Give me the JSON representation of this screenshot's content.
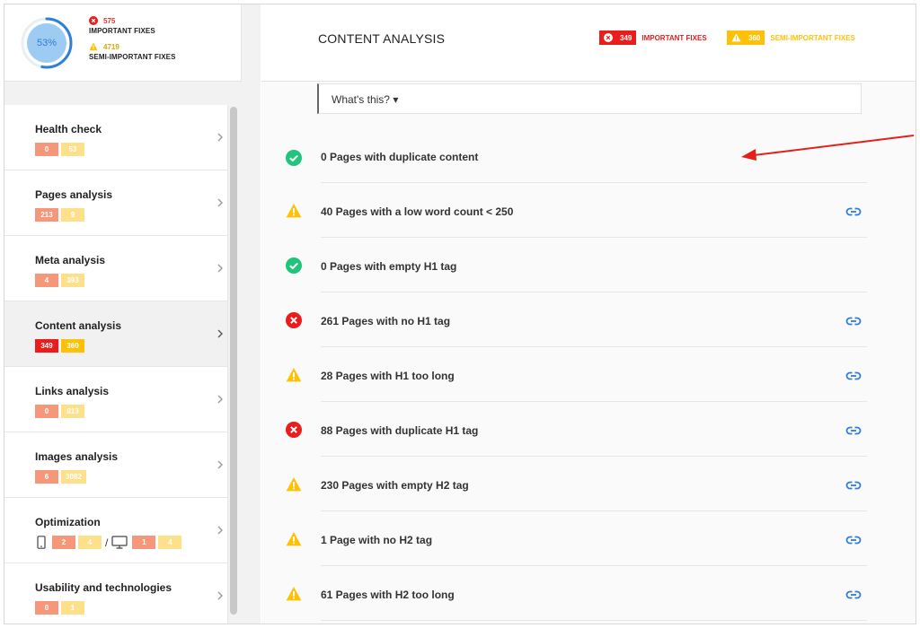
{
  "summary": {
    "score": "53%",
    "score_fraction": 0.53,
    "important_count": "575",
    "important_label": "IMPORTANT FIXES",
    "semi_count": "4719",
    "semi_label": "SEMI-IMPORTANT FIXES"
  },
  "nav": [
    {
      "title": "Health check",
      "badges": [
        "0",
        "53"
      ]
    },
    {
      "title": "Pages analysis",
      "badges": [
        "213",
        "9"
      ]
    },
    {
      "title": "Meta analysis",
      "badges": [
        "4",
        "393"
      ]
    },
    {
      "title": "Content analysis",
      "badges": [
        "349",
        "360"
      ]
    },
    {
      "title": "Links analysis",
      "badges": [
        "0",
        "813"
      ]
    },
    {
      "title": "Images analysis",
      "badges": [
        "6",
        "3082"
      ]
    },
    {
      "title": "Optimization",
      "mobile_badges": [
        "2",
        "4"
      ],
      "separator": "/",
      "desktop_badges": [
        "1",
        "4"
      ]
    },
    {
      "title": "Usability and technologies",
      "badges": [
        "0",
        "1"
      ]
    }
  ],
  "header": {
    "title": "CONTENT ANALYSIS",
    "important_count": "349",
    "important_label": "IMPORTANT FIXES",
    "semi_count": "360",
    "semi_label": "SEMI-IMPORTANT FIXES"
  },
  "whats_this": "What's this? ▾",
  "checks": [
    {
      "status": "ok",
      "text": "0 Pages with duplicate content",
      "link": false
    },
    {
      "status": "warn",
      "text": "40 Pages with a low word count < 250",
      "link": true
    },
    {
      "status": "ok",
      "text": "0 Pages with empty H1 tag",
      "link": false
    },
    {
      "status": "error",
      "text": "261 Pages with no H1 tag",
      "link": true
    },
    {
      "status": "warn",
      "text": "28 Pages with H1 too long",
      "link": true
    },
    {
      "status": "error",
      "text": "88 Pages with duplicate H1 tag",
      "link": true
    },
    {
      "status": "warn",
      "text": "230 Pages with empty H2 tag",
      "link": true
    },
    {
      "status": "warn",
      "text": "1 Page with no H2 tag",
      "link": true
    },
    {
      "status": "warn",
      "text": "61 Pages with H2 too long",
      "link": true
    }
  ],
  "colors": {
    "error": "#ea1c1c",
    "warning": "#ffc107",
    "ok": "#20c47b",
    "link": "#2f7ed8",
    "gauge": "#2f7ed8"
  }
}
